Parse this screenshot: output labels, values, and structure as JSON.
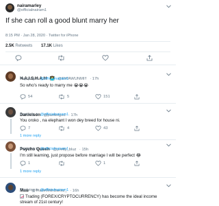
{
  "main_tweet": {
    "display_name": "nairamarley",
    "handle": "@officialnairam1",
    "text": "If she can roll a good blunt marry her",
    "timestamp": "8:15 PM · Jan 28, 2020 · Twitter for iPhone",
    "retweets_count": "2.5K",
    "retweets_label": "Retweets",
    "likes_count": "17.1K",
    "likes_label": "Likes"
  },
  "replies": [
    {
      "display_name": "H.A.I.S.H.A.H",
      "name_emoji": "👩‍💻",
      "handle": "@EWAWUNMI!!",
      "time": "· 17h",
      "replying_label": "Replying to",
      "replying_handle": "@officialnairam1",
      "text": "So who's ready to marry me",
      "text_emoji": "😭😭😭",
      "reply_count": "54",
      "retweet_count": "5",
      "like_count": "151"
    },
    {
      "display_name": "Danielson",
      "handle": "@parttofgod",
      "time": "· 17h",
      "replying_label": "Replying to",
      "replying_handle": "@officialnairam1",
      "text": "You oroko , na elephant I won dey breed for house ni.",
      "reply_count": "7",
      "retweet_count": "4",
      "like_count": "43",
      "more_label": "1 more reply"
    },
    {
      "display_name": "Psycho Queen",
      "handle": "@pretty_bluz",
      "time": "· 15h",
      "replying_label": "Replying to",
      "replying_handle": "@officialnairam1",
      "text": "I'm still learning, just propose before marriage I will be perfect",
      "text_emoji": "😂",
      "reply_count": "1",
      "retweet_count": "",
      "like_count": "1",
      "more_label": "1 more reply"
    },
    {
      "display_name": "Mau",
      "handle": "@TradeWithBankz_",
      "time": "· 16h",
      "replying_label": "Replying to",
      "replying_handle": "@officialnairam1",
      "text_line1": "Trading (FOREX/CRYPTOCURRENCY) has become the ideal income",
      "text_line2": "stream of 21st century!"
    }
  ],
  "colors": {
    "accent": "#1da1f2",
    "muted": "#657786",
    "divider": "#e6ecf0"
  },
  "icons": [
    "chevron-down-icon",
    "reply-icon",
    "retweet-icon",
    "like-icon",
    "share-icon"
  ]
}
